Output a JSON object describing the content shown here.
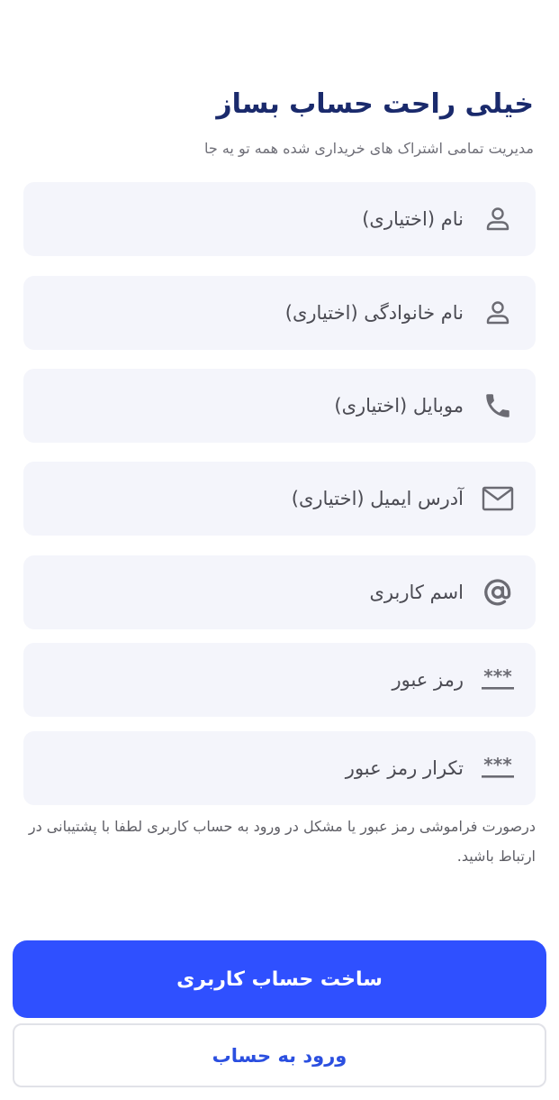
{
  "header": {
    "title": "خیلی راحت حساب بساز",
    "subtitle": "مدیریت تمامی اشتراک های خریداری شده همه تو یه جا"
  },
  "form": {
    "first_name": {
      "placeholder": "نام (اختیاری)",
      "icon": "person-icon"
    },
    "last_name": {
      "placeholder": "نام خانوادگی (اختیاری)",
      "icon": "person-icon"
    },
    "mobile": {
      "placeholder": "موبایل (اختیاری)",
      "icon": "phone-icon"
    },
    "email": {
      "placeholder": "آدرس ایمیل (اختیاری)",
      "icon": "mail-icon"
    },
    "username": {
      "placeholder": "اسم کاربری",
      "icon": "at-sign-icon"
    },
    "password": {
      "placeholder": "رمز عبور",
      "icon": "password-icon"
    },
    "password_confirm": {
      "placeholder": "تکرار رمز عبور",
      "icon": "password-icon"
    }
  },
  "note": "درصورت فراموشی رمز عبور یا مشکل در ورود به حساب کاربری لطفا با پشتیبانی در ارتباط باشید.",
  "actions": {
    "create_account_label": "ساخت حساب کاربری",
    "login_label": "ورود به حساب"
  },
  "colors": {
    "primary": "#2f50ff",
    "title": "#1a2a6c",
    "field_bg": "#f4f5fb",
    "icon": "#6b6b73"
  }
}
